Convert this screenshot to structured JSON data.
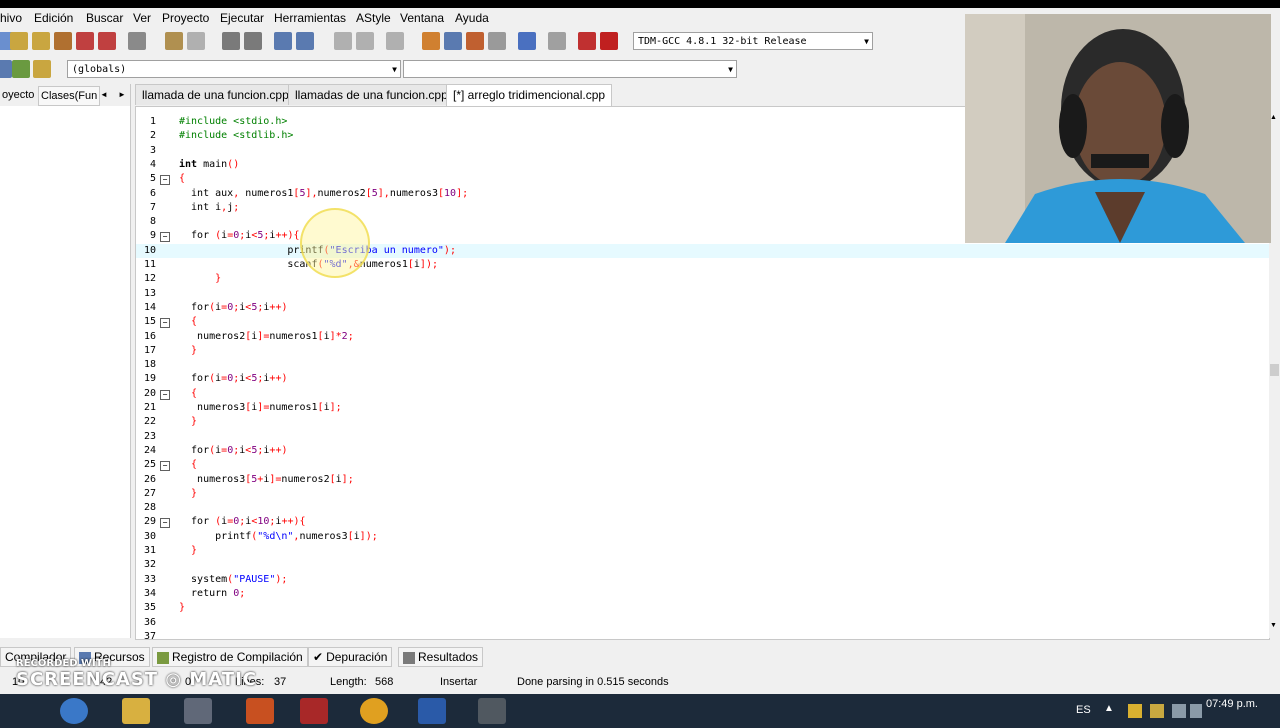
{
  "menu": [
    "hivo",
    "Edición",
    "Buscar",
    "Ver",
    "Proyecto",
    "Ejecutar",
    "Herramientas",
    "AStyle",
    "Ventana",
    "Ayuda"
  ],
  "compiler_select": "TDM-GCC 4.8.1 32-bit Release",
  "scope_select": "(globals)",
  "left_tabs": [
    "oyecto",
    "Clases(Fun"
  ],
  "file_tabs": [
    "llamada de una funcion.cpp",
    "llamadas de una funcion.cpp",
    "[*] arreglo tridimencional.cpp"
  ],
  "code_lines": [
    {
      "n": "1",
      "t": "#include <stdio.h>"
    },
    {
      "n": "2",
      "t": "#include <stdlib.h>"
    },
    {
      "n": "3",
      "t": ""
    },
    {
      "n": "4",
      "t": "int main()"
    },
    {
      "n": "5",
      "t": "{"
    },
    {
      "n": "6",
      "t": "  int aux, numeros1[5],numeros2[5],numeros3[10];"
    },
    {
      "n": "7",
      "t": "  int i,j;"
    },
    {
      "n": "8",
      "t": ""
    },
    {
      "n": "9",
      "t": "  for (i=0;i<5;i++){"
    },
    {
      "n": "10",
      "t": "                  printf(\"Escriba un numero\");"
    },
    {
      "n": "11",
      "t": "                  scanf(\"%d\",&numeros1[i]);"
    },
    {
      "n": "12",
      "t": "      }"
    },
    {
      "n": "13",
      "t": ""
    },
    {
      "n": "14",
      "t": "  for(i=0;i<5;i++)"
    },
    {
      "n": "15",
      "t": "  {"
    },
    {
      "n": "16",
      "t": "   numeros2[i]=numeros1[i]*2;"
    },
    {
      "n": "17",
      "t": "  }"
    },
    {
      "n": "18",
      "t": ""
    },
    {
      "n": "19",
      "t": "  for(i=0;i<5;i++)"
    },
    {
      "n": "20",
      "t": "  {"
    },
    {
      "n": "21",
      "t": "   numeros3[i]=numeros1[i];"
    },
    {
      "n": "22",
      "t": "  }"
    },
    {
      "n": "23",
      "t": ""
    },
    {
      "n": "24",
      "t": "  for(i=0;i<5;i++)"
    },
    {
      "n": "25",
      "t": "  {"
    },
    {
      "n": "26",
      "t": "   numeros3[5+i]=numeros2[i];"
    },
    {
      "n": "27",
      "t": "  }"
    },
    {
      "n": "28",
      "t": ""
    },
    {
      "n": "29",
      "t": "  for (i=0;i<10;i++){"
    },
    {
      "n": "30",
      "t": "      printf(\"%d\\n\",numeros3[i]);"
    },
    {
      "n": "31",
      "t": "  }"
    },
    {
      "n": "32",
      "t": ""
    },
    {
      "n": "33",
      "t": "  system(\"PAUSE\");"
    },
    {
      "n": "34",
      "t": "  return 0;"
    },
    {
      "n": "35",
      "t": "}"
    },
    {
      "n": "36",
      "t": ""
    },
    {
      "n": "37",
      "t": ""
    }
  ],
  "fold_lines": [
    "5",
    "9",
    "15",
    "20",
    "25",
    "29"
  ],
  "highlight_line": "10",
  "bottom_tabs": [
    "Compilador",
    "Recursos",
    "Registro de Compilación",
    "Depuración",
    "Resultados"
  ],
  "status": {
    "line": "10",
    "col": "42",
    "sel": "0",
    "lines_label": "Lines:",
    "lines": "37",
    "length_label": "Length:",
    "length": "568",
    "mode": "Insertar",
    "message": "Done parsing in 0.515 seconds"
  },
  "taskbar": {
    "lang": "ES",
    "time": "07:49 p.m."
  },
  "watermark": {
    "line1": "RECORDED WITH",
    "line2": "SCREENCAST",
    "line3": "MATIC"
  },
  "colors": {
    "highlight": "#e6faff",
    "preproc": "#008000",
    "string": "#0000ff",
    "number": "#800080",
    "symbol": "#ff0000"
  }
}
